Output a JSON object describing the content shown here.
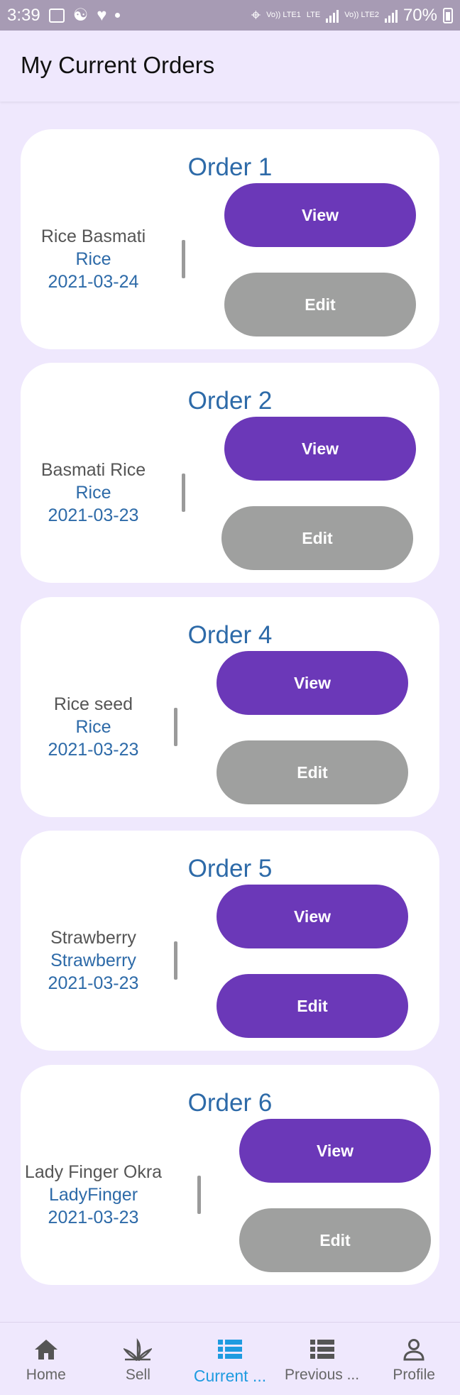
{
  "status_bar": {
    "time": "3:39",
    "volte1": "Vo)) LTE1",
    "lte": "LTE",
    "volte2": "Vo)) LTE2",
    "battery": "70%"
  },
  "header": {
    "title": "My Current Orders"
  },
  "orders": [
    {
      "title": "Order 1",
      "name": "Rice Basmati",
      "category": "Rice",
      "date": "2021-03-24",
      "view_label": "View",
      "edit_label": "Edit"
    },
    {
      "title": "Order 2",
      "name": "Basmati Rice",
      "category": "Rice",
      "date": "2021-03-23",
      "view_label": "View",
      "edit_label": "Edit"
    },
    {
      "title": "Order 4",
      "name": "Rice seed",
      "category": "Rice",
      "date": "2021-03-23",
      "view_label": "View",
      "edit_label": "Edit"
    },
    {
      "title": "Order 5",
      "name": "Strawberry",
      "category": "Strawberry",
      "date": "2021-03-23",
      "view_label": "View",
      "edit_label": "Edit"
    },
    {
      "title": "Order 6",
      "name": "Lady Finger Okra",
      "category": "LadyFinger",
      "date": "2021-03-23",
      "view_label": "View",
      "edit_label": "Edit"
    }
  ],
  "bottom_nav": [
    {
      "label": "Home",
      "icon": "home-icon"
    },
    {
      "label": "Sell",
      "icon": "plant-icon"
    },
    {
      "label": "Current ...",
      "icon": "list-icon",
      "active": true
    },
    {
      "label": "Previous ...",
      "icon": "list-icon"
    },
    {
      "label": "Profile",
      "icon": "person-icon"
    }
  ],
  "colors": {
    "accent": "#6b38b8",
    "edit_gray": "#9fa09f",
    "text_blue": "#2d6aa8",
    "background": "#efe8fd",
    "nav_active": "#1e9be0"
  }
}
